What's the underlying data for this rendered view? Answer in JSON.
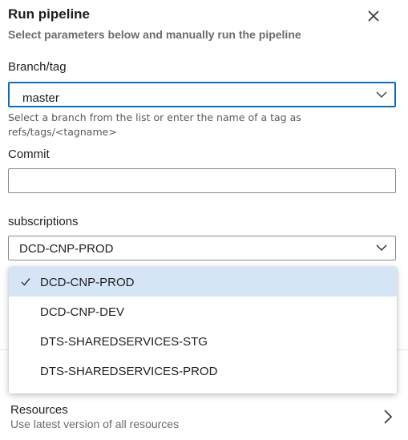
{
  "header": {
    "title": "Run pipeline",
    "subtitle": "Select parameters below and manually run the pipeline",
    "close_icon": "close-icon"
  },
  "branch": {
    "label": "Branch/tag",
    "value": "master",
    "help": "Select a branch from the list or enter the name of a tag as refs/tags/<tagname>"
  },
  "commit": {
    "label": "Commit",
    "value": ""
  },
  "subscriptions": {
    "label": "subscriptions",
    "value": "DCD-CNP-PROD",
    "options": [
      {
        "label": "DCD-CNP-PROD",
        "selected": true
      },
      {
        "label": "DCD-CNP-DEV",
        "selected": false
      },
      {
        "label": "DTS-SHAREDSERVICES-STG",
        "selected": false
      },
      {
        "label": "DTS-SHAREDSERVICES-PROD",
        "selected": false
      }
    ]
  },
  "resources": {
    "title": "Resources",
    "subtitle": "Use latest version of all resources"
  },
  "colors": {
    "accent": "#0f6cbd",
    "selected_bg": "#d5e5f6"
  }
}
